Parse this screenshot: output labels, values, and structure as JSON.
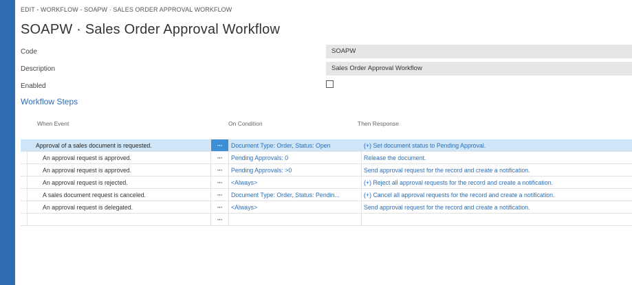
{
  "breadcrumb": "EDIT - WORKFLOW - SOAPW · SALES ORDER APPROVAL WORKFLOW",
  "title": "SOAPW · Sales Order Approval Workflow",
  "fields": {
    "code": {
      "label": "Code",
      "value": "SOAPW"
    },
    "description": {
      "label": "Description",
      "value": "Sales Order Approval Workflow"
    },
    "enabled": {
      "label": "Enabled",
      "checked": false
    }
  },
  "steps": {
    "title": "Workflow Steps",
    "columns": {
      "event": "When Event",
      "condition": "On Condition",
      "response": "Then Response"
    },
    "assist_glyph": "···",
    "rows": [
      {
        "event": "Approval of a sales document is requested.",
        "indent": 0,
        "condition": "Document Type: Order, Status: Open",
        "response": "(+) Set document status to Pending Approval.",
        "selected": true
      },
      {
        "event": "An approval request is approved.",
        "indent": 1,
        "condition": "Pending Approvals: 0",
        "response": "Release the document.",
        "selected": false
      },
      {
        "event": "An approval request is approved.",
        "indent": 1,
        "condition": "Pending Approvals: >0",
        "response": "Send approval request for the record and create a notification.",
        "selected": false
      },
      {
        "event": "An approval request is rejected.",
        "indent": 1,
        "condition": "<Always>",
        "response": "(+) Reject all approval requests for the record and create a notification.",
        "selected": false
      },
      {
        "event": "A sales document request is canceled.",
        "indent": 1,
        "condition": "Document Type: Order, Status: Pendin...",
        "response": "(+) Cancel all approval requests for the record and create a notification.",
        "selected": false
      },
      {
        "event": "An approval request is delegated.",
        "indent": 1,
        "condition": "<Always>",
        "response": "Send approval request for the record and create a notification.",
        "selected": false
      },
      {
        "event": "",
        "indent": 0,
        "condition": "",
        "response": "",
        "selected": false
      }
    ]
  }
}
